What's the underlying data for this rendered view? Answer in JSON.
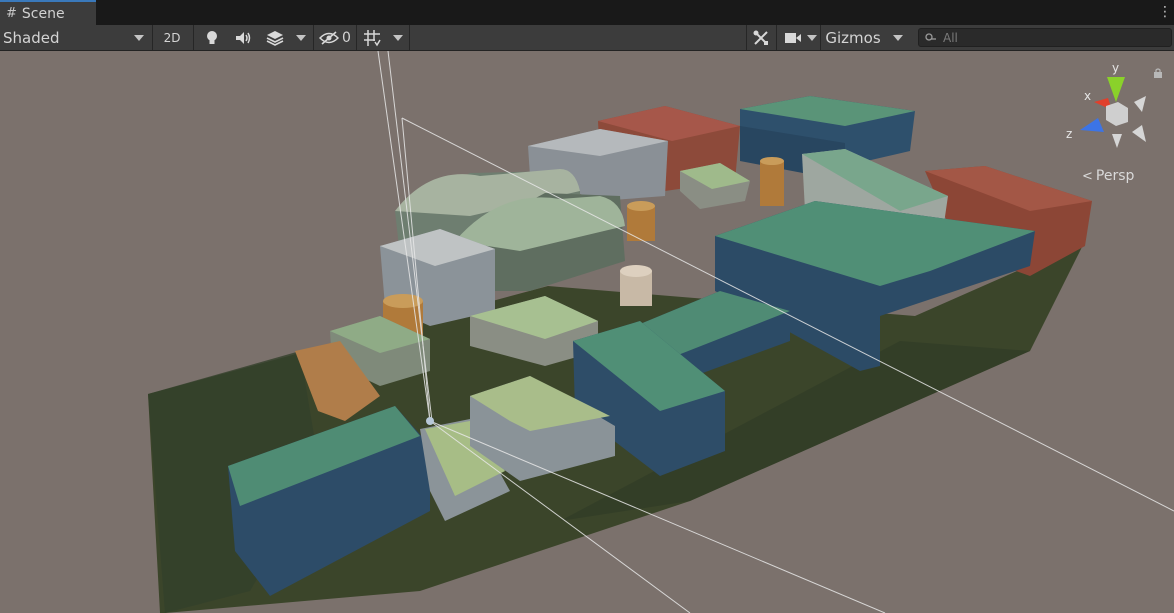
{
  "tab": {
    "title": "Scene",
    "icon": "scene-grid-icon"
  },
  "window_menu": {
    "icon": "kebab-menu-icon"
  },
  "toolbar": {
    "draw_mode": "Shaded",
    "toggle_2d": "2D",
    "lighting_icon": "lightbulb-icon",
    "audio_icon": "speaker-icon",
    "effects_icon": "effects-layers-icon",
    "hidden_count": "0",
    "hidden_icon": "eye-hidden-icon",
    "grid_icon": "grid-snap-icon",
    "tools_icon": "tools-icon",
    "camera_icon": "camera-icon",
    "gizmos": "Gizmos",
    "search_placeholder": "All",
    "search_icon": "search-icon"
  },
  "viewport": {
    "projection_label": "Persp",
    "axis_labels": {
      "x": "x",
      "y": "y",
      "z": "z"
    },
    "colors": {
      "background": "#7b716c",
      "x_axis": "#e0402c",
      "y_axis": "#8ad12a",
      "z_axis": "#3c74e6",
      "roof_green": "#4f8a72",
      "wall_blue": "#2d4e6a",
      "roof_rust": "#a04a3a",
      "ground": "#3e4a2a"
    }
  }
}
